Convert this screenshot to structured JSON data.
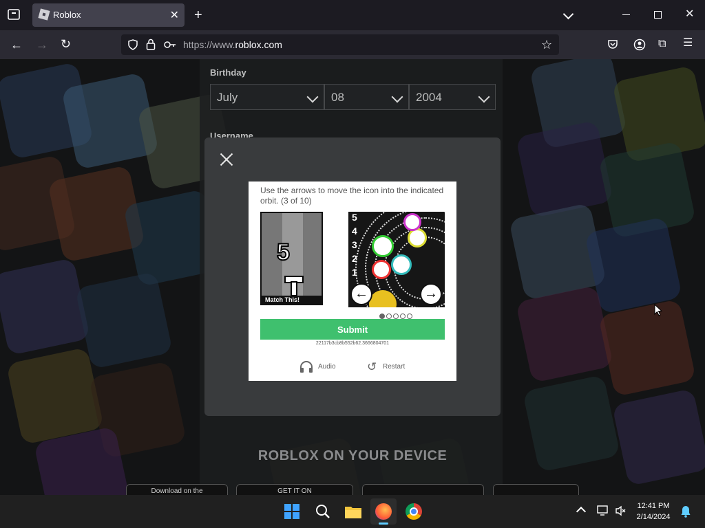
{
  "browser": {
    "tab_title": "Roblox",
    "url_host_prefix": "https://www.",
    "url_host": "roblox.com"
  },
  "page": {
    "birthday_label": "Birthday",
    "month_value": "July",
    "day_value": "08",
    "year_value": "2004",
    "username_label": "Username",
    "device_title": "ROBLOX ON YOUR DEVICE",
    "store_buttons": [
      "Download on the",
      "GET IT ON",
      "",
      ""
    ]
  },
  "captcha": {
    "instruction": "Use the arrows to move the icon into the indicated orbit. (3 of 10)",
    "target_number": "5",
    "match_label": "Match This!",
    "orbit_numbers": [
      "5",
      "4",
      "3",
      "2",
      "1"
    ],
    "submit_label": "Submit",
    "session_id": "22117b3cb8b552b62.3666804701",
    "audio_label": "Audio",
    "restart_label": "Restart",
    "progress_dots": 5,
    "active_dot": 1
  },
  "taskbar": {
    "time": "12:41 PM",
    "date": "2/14/2024"
  },
  "colors": {
    "submit": "#3fc06e",
    "browser_bg": "#1c1b22",
    "taskbar_bg": "#202020"
  }
}
